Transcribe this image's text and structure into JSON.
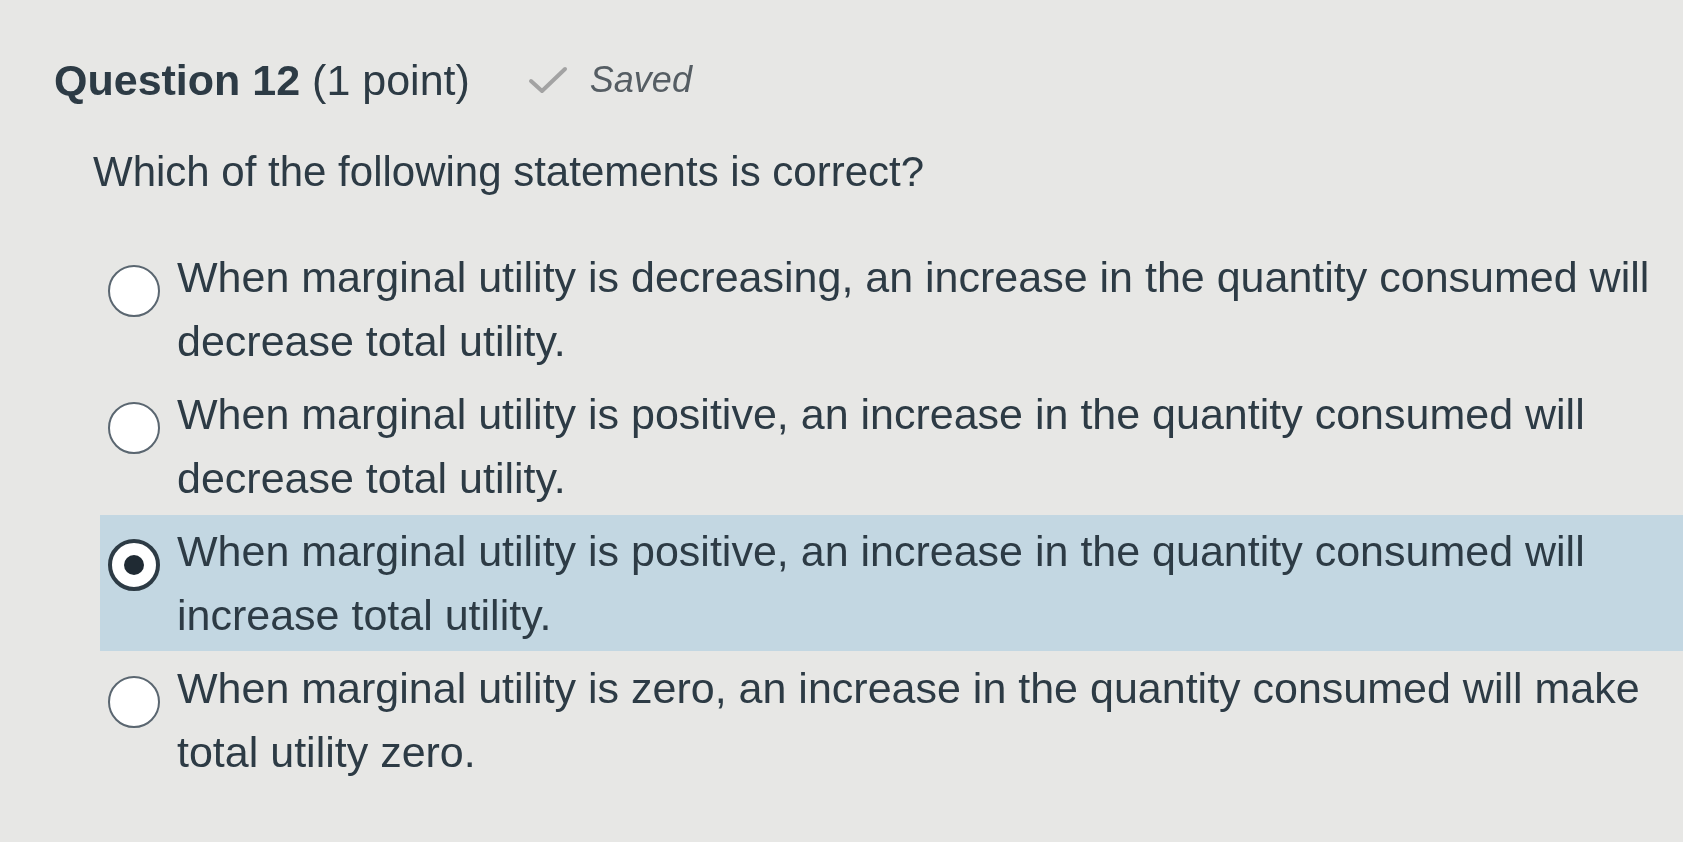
{
  "header": {
    "title": "**Question 12** (1 point)",
    "save_status": "Saved"
  },
  "question": "Which of the following statements is correct?",
  "options": [
    {
      "text": "When marginal utility is decreasing, an increase in the quantity consumed will decrease total utility.",
      "selected": false
    },
    {
      "text": "When marginal utility is positive, an increase in the quantity consumed will decrease total utility.",
      "selected": false
    },
    {
      "text": "When marginal utility is positive, an increase in the quantity consumed will increase total utility.",
      "selected": true
    },
    {
      "text": "When marginal utility is zero, an increase in the quantity consumed will make total utility zero.",
      "selected": false
    }
  ]
}
